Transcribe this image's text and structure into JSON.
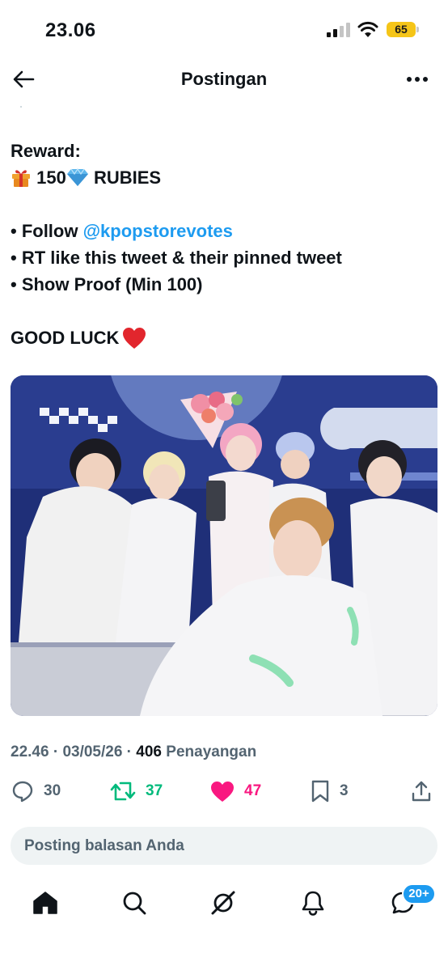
{
  "status_bar": {
    "time": "23.06",
    "battery": "65",
    "battery_color": "#f5c518"
  },
  "header": {
    "title": "Postingan",
    "back_icon": "arrow-left-icon",
    "more_icon": "more-horizontal-icon"
  },
  "tweet": {
    "reward_label": "Reward:",
    "reward_amount": "150",
    "reward_unit": "RUBIES",
    "bullet_follow_prefix": "• Follow ",
    "mention": "@kpopstorevotes",
    "bullet_rt": "• RT like this tweet & their pinned tweet",
    "bullet_proof": "• Show Proof (Min 100)",
    "closing": "GOOD LUCK",
    "icons": [
      "gift-emoji",
      "gem-emoji",
      "red-heart-emoji"
    ],
    "photo_icon": "group-photo",
    "mention_color": "#1d9bf0"
  },
  "meta": {
    "time": "22.46",
    "separator": " · ",
    "date": "03/05/26",
    "views_count": "406",
    "views_label": "Penayangan"
  },
  "actions": {
    "reply_count": "30",
    "retweet_count": "37",
    "like_count": "47",
    "bookmark_count": "3",
    "colors": {
      "retweet": "#00ba7c",
      "like": "#f91880",
      "muted": "#536471"
    }
  },
  "reply_box": {
    "placeholder": "Posting balasan Anda"
  },
  "bottom_nav": {
    "items": [
      "home-icon",
      "search-icon",
      "grok-icon",
      "notifications-icon",
      "messages-icon"
    ],
    "messages_badge": "20+",
    "badge_color": "#1d9bf0"
  }
}
